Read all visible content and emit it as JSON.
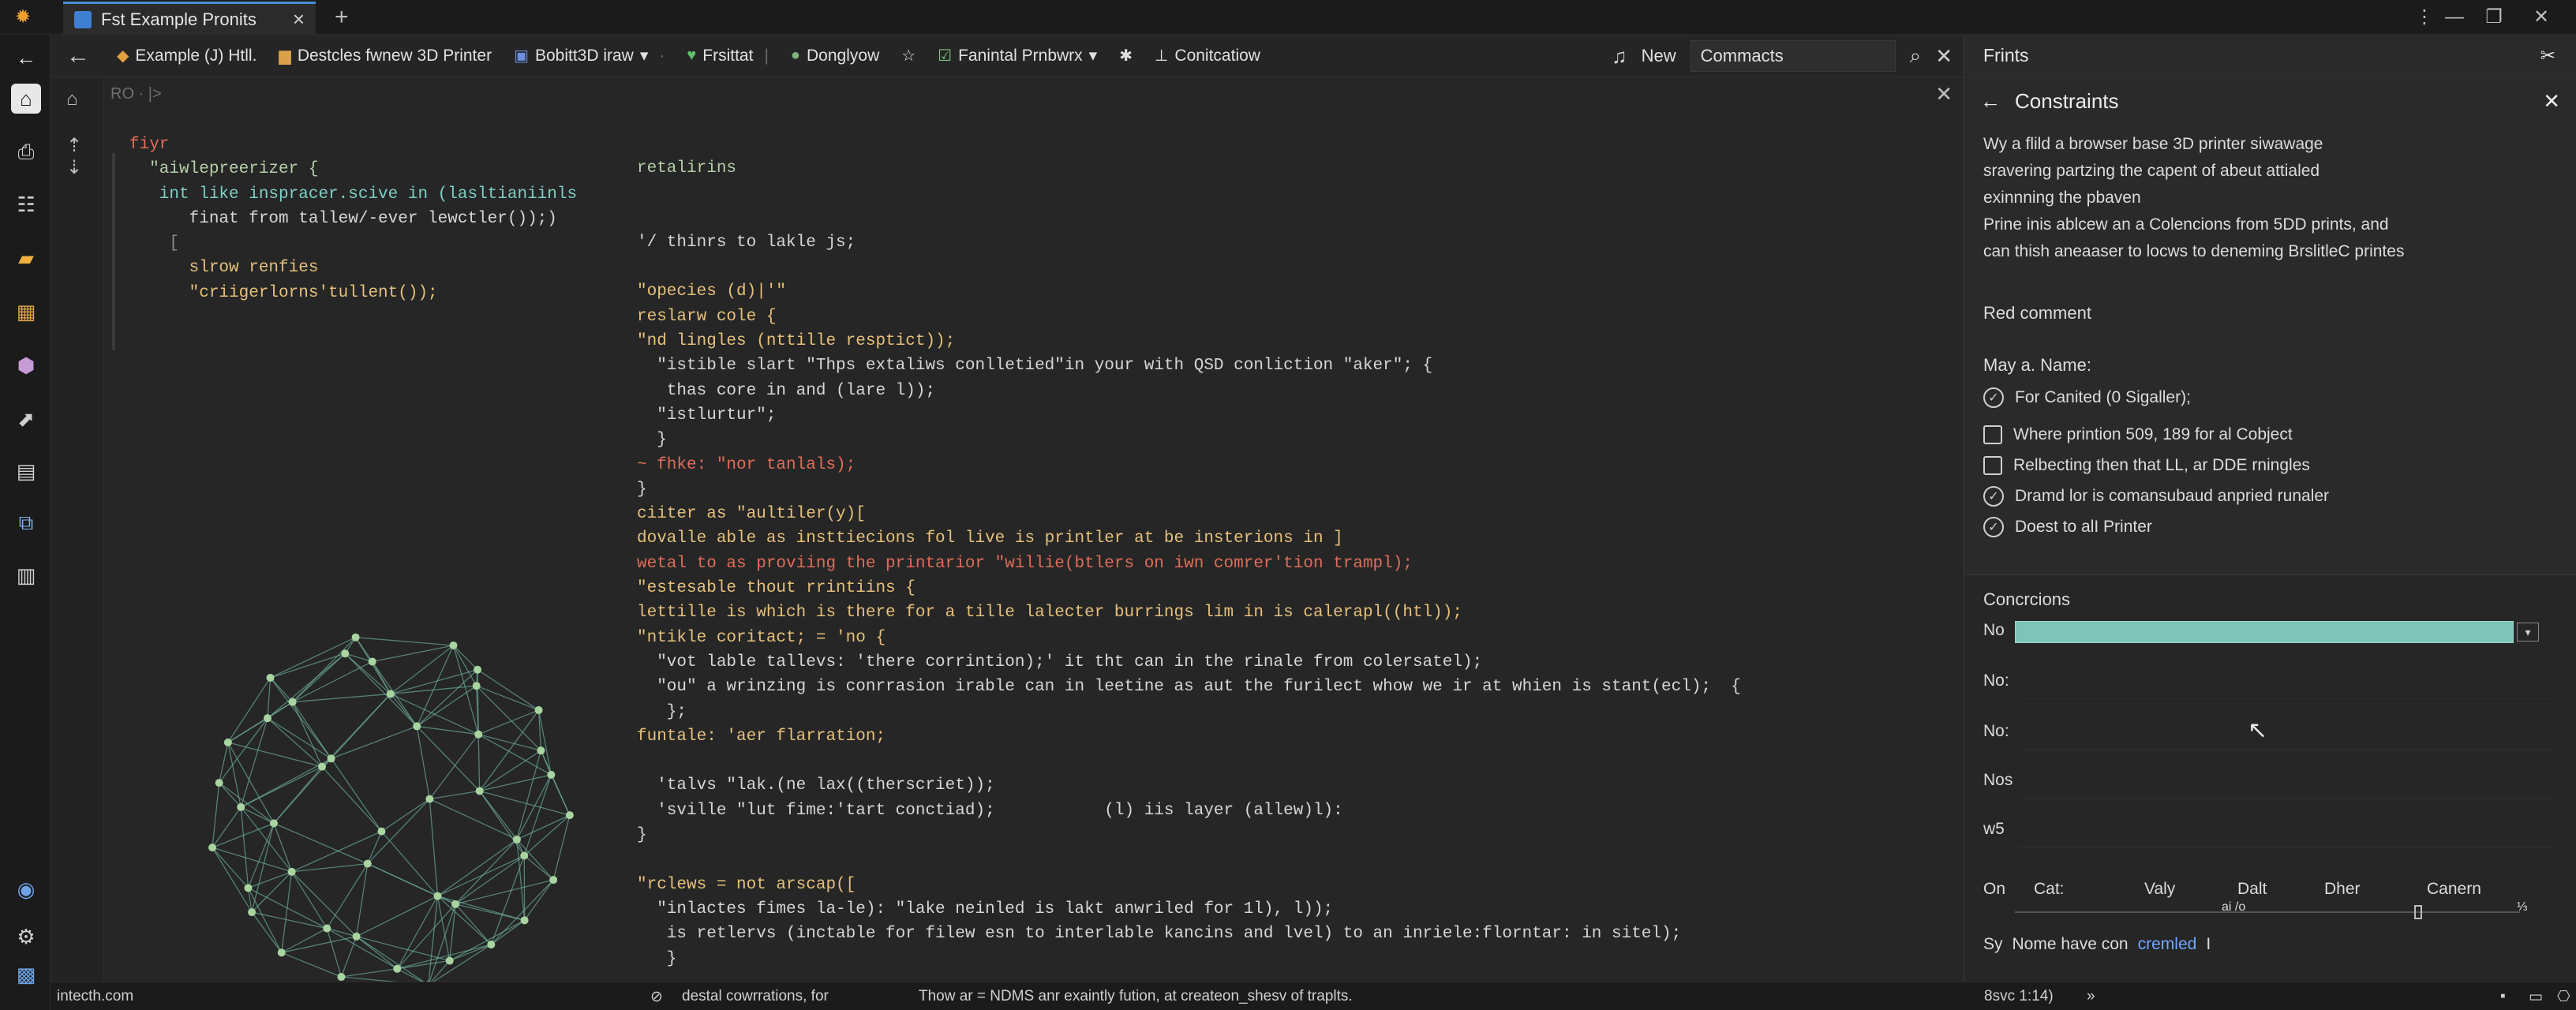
{
  "window": {
    "tab_title": "Fst Example Pronits",
    "new_tab": "+",
    "controls": [
      "⋮",
      "—",
      "❐",
      "✕"
    ]
  },
  "activity_bar": {
    "items": [
      "home-icon",
      "printer-icon",
      "layers-icon",
      "folder-icon",
      "grid-icon",
      "package-icon",
      "chart-icon",
      "cube-icon",
      "puzzle-icon",
      "file-icon",
      "globe-icon",
      "settings-icon"
    ]
  },
  "toolbar": {
    "back": "←",
    "crumbs": [
      {
        "icon": "◆",
        "label": "Example (J) Htll."
      },
      {
        "icon": "▆",
        "label": "Destcles fwnew 3D Printer"
      },
      {
        "icon": "▣",
        "label": "Bobitt3D iraw",
        "caret": "▾"
      },
      {
        "icon": "♥",
        "label": "Frsittat"
      },
      {
        "icon": "●",
        "label": "Donglyow"
      },
      {
        "icon": "☆",
        "label": ""
      },
      {
        "icon": "☑",
        "label": "Fanintal Prnbwrx",
        "caret": "▾"
      },
      {
        "icon": "✱",
        "label": ""
      },
      {
        "icon": "⊥",
        "label": "Conitcatiow"
      }
    ],
    "new_label": "New",
    "search_value": "Commacts"
  },
  "editor": {
    "path": "RO · |>",
    "left_code": [
      "fiyr",
      "  \"aiwlepreerizer {",
      "   int like inspracer.scive in (lasltianiinls",
      "      finat from tallew/-ever lewctler());)",
      "    [",
      "      slrow renfies",
      "      \"criigerlorns'tullent());"
    ],
    "right_code": [
      "retalirins",
      "",
      "",
      "'/ thinrs to lakle js;",
      "",
      "\"opecies (d)|'\"",
      "reslarw cole {",
      "\"nd lingles (nttille resptict));",
      "  \"istible slart \"Thps extaliws conlletied\"in your with QSD conliction \"aker\"; {",
      "   thas core in and (lare l));",
      "  \"istlurtur\";",
      "  }",
      "~ fhke: \"nor tanlals);",
      "}",
      "ciiter as \"aultiler(y)[",
      "dovalle able as insttiecions fol live is printler at be insterions in ]",
      "wetal to as proviing the printarior \"willie(btlers on iwn comrer'tion trampl);",
      "\"estesable thout rrintiins {",
      "lettille is which is there for a tille lalecter burrings lim in is calerapl((htl));",
      "\"ntikle coritact; = 'no {",
      "  \"vot lable tallevs: 'there corrintion);' it tht can in the rinale from colersatel);",
      "  \"ou\" a wrinzing is conrrasion irable can in leetine as aut the furilect whow we ir at whien is stant(ecl);  {",
      "   };",
      "funtale: 'aer flarration;",
      "",
      "  'talvs \"lak.(ne lax((therscriet));",
      "  'sville \"lut fime:'tart conctiad);           (l) iis layer (allew)l):",
      "}",
      "",
      "\"rclews = not arscap([",
      "  \"inlactes fimes la-le): \"lake neinled is lakt anwriled for 1l), l));",
      "   is retlervs (inctable for filew esn to interlable kancins and lvel) to an inriele:florntar: in sitel);",
      "   }"
    ]
  },
  "status": {
    "left": "intecth.com",
    "middle_icon": "⊘",
    "middle": "destal cowrrations, for",
    "message": "Thow ar = NDMS anr exaintly fution, at createon_shesv of traplts.",
    "position": "8svc 1:14)",
    "right_icons": [
      "»",
      "▪",
      "▭",
      "⎔"
    ]
  },
  "panel": {
    "title": "Frints",
    "pin_icon": "pin-icon",
    "constraints": {
      "title": "Constraints",
      "description": [
        "Wy a flild a browser base 3D printer siwawage",
        "sravering partzing the capent of abeut attialed",
        "exinnning the pbaven",
        "Prine inis ablcew an a Colencions from 5DD prints, and",
        "can thish aneaaser to locws to deneming BrslitleC printes"
      ],
      "red_comment": "Red comment",
      "name_label": "May a. Name:",
      "items": [
        {
          "type": "circle",
          "checked": true,
          "label": "For Canited (0 Sigaller);"
        },
        {
          "type": "box",
          "checked": false,
          "label": "Where printion 509, 189 for al Cobject"
        },
        {
          "type": "box",
          "checked": false,
          "label": "Relbecting then that LL, ar DDE rningles"
        },
        {
          "type": "circle",
          "checked": true,
          "label": "Dramd lor is comansubaud anpried runaler"
        },
        {
          "type": "circle",
          "checked": true,
          "label": "Doest to alI Printer"
        }
      ]
    },
    "conversions": {
      "title": "Concrcions",
      "rows": [
        "No",
        "No:",
        "No:",
        "Nos",
        "w5"
      ],
      "bar_dropdown": "▾",
      "footer_label": "On",
      "columns": [
        "Cat:",
        "Valy",
        "Dalt",
        "Dher",
        "Canern"
      ],
      "slider_mid": "ai /o",
      "slider_end": "⅓",
      "bottom_icon": "Sy",
      "bottom_text": "Nome have con",
      "bottom_link": "cremled"
    }
  }
}
